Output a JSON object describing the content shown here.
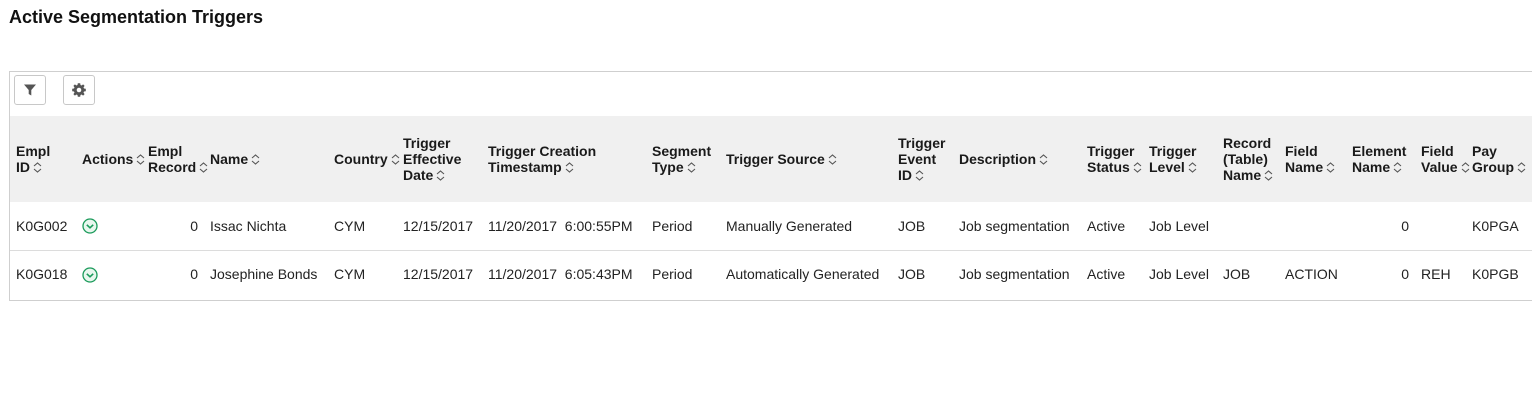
{
  "page": {
    "title": "Active Segmentation Triggers"
  },
  "toolbar": {
    "filter_icon": "filter-icon",
    "settings_icon": "gear-icon"
  },
  "columns": [
    {
      "key": "empl_id",
      "lines": [
        "Empl",
        "ID"
      ]
    },
    {
      "key": "actions",
      "lines": [
        "Actions"
      ]
    },
    {
      "key": "empl_record",
      "lines": [
        "Empl",
        "Record"
      ]
    },
    {
      "key": "name",
      "lines": [
        "Name"
      ]
    },
    {
      "key": "country",
      "lines": [
        "Country"
      ]
    },
    {
      "key": "trigger_effective_date",
      "lines": [
        "Trigger",
        "Effective",
        "Date"
      ]
    },
    {
      "key": "trigger_creation_timestamp",
      "lines": [
        "Trigger Creation",
        "Timestamp"
      ]
    },
    {
      "key": "segment_type",
      "lines": [
        "Segment",
        "Type"
      ]
    },
    {
      "key": "trigger_source",
      "lines": [
        "Trigger Source"
      ]
    },
    {
      "key": "trigger_event_id",
      "lines": [
        "Trigger",
        "Event",
        "ID"
      ]
    },
    {
      "key": "description",
      "lines": [
        "Description"
      ]
    },
    {
      "key": "trigger_status",
      "lines": [
        "Trigger",
        "Status"
      ]
    },
    {
      "key": "trigger_level",
      "lines": [
        "Trigger",
        "Level"
      ]
    },
    {
      "key": "record_table_name",
      "lines": [
        "Record",
        "(Table)",
        "Name"
      ]
    },
    {
      "key": "field_name",
      "lines": [
        "Field",
        "Name"
      ]
    },
    {
      "key": "element_name",
      "lines": [
        "Element",
        "Name"
      ]
    },
    {
      "key": "field_value",
      "lines": [
        "Field",
        "Value"
      ]
    },
    {
      "key": "pay_group",
      "lines": [
        "Pay",
        "Group"
      ]
    }
  ],
  "rows": [
    {
      "empl_id": "K0G002",
      "actions": "",
      "empl_record": "0",
      "name": "Issac Nichta",
      "country": "CYM",
      "trigger_effective_date": "12/15/2017",
      "trigger_creation_timestamp": "11/20/2017  6:00:55PM",
      "segment_type": "Period",
      "trigger_source": "Manually Generated",
      "trigger_event_id": "JOB",
      "description": "Job segmentation",
      "trigger_status": "Active",
      "trigger_level": "Job Level",
      "record_table_name": "",
      "field_name": "",
      "element_name": "0",
      "field_value": "",
      "pay_group": "K0PGA"
    },
    {
      "empl_id": "K0G018",
      "actions": "",
      "empl_record": "0",
      "name": "Josephine Bonds",
      "country": "CYM",
      "trigger_effective_date": "12/15/2017",
      "trigger_creation_timestamp": "11/20/2017  6:05:43PM",
      "segment_type": "Period",
      "trigger_source": "Automatically Generated",
      "trigger_event_id": "JOB",
      "description": "Job segmentation",
      "trigger_status": "Active",
      "trigger_level": "Job Level",
      "record_table_name": "JOB",
      "field_name": "ACTION",
      "element_name": "0",
      "field_value": "REH",
      "pay_group": "K0PGB"
    }
  ],
  "colors": {
    "header_bg": "#f0f0f0",
    "action_icon": "#1a9a5a",
    "border": "#cfcfcf"
  }
}
